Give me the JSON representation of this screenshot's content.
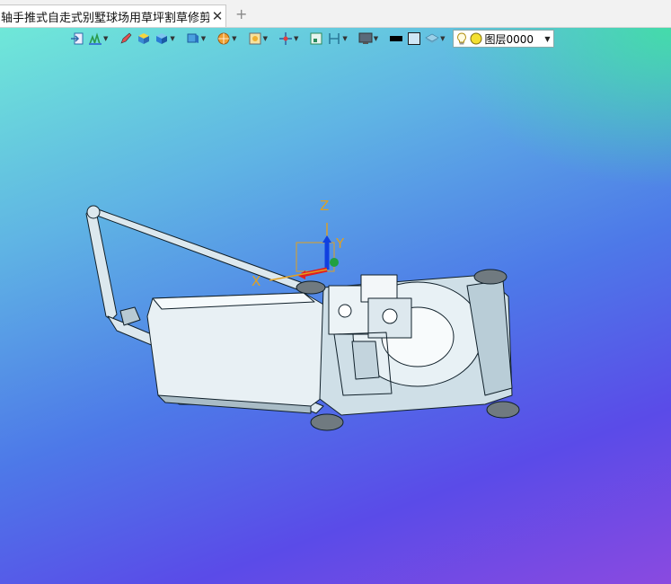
{
  "tab": {
    "title": "轴手推式自走式别墅球场用草坪割草修剪机]",
    "close_glyph": "✕",
    "new_tab_glyph": "+"
  },
  "toolbar": {
    "items": [
      "import-icon",
      "lawn-tool-icon",
      "pencil-icon",
      "cube-yellow-icon",
      "cube-blue-icon",
      "view-cube-icon",
      "render-style-icon",
      "image-frame-icon",
      "axis-move-icon",
      "fit-box-icon",
      "section-icon",
      "display-icon",
      "black-swatch",
      "white-swatch",
      "layer-stack-icon"
    ],
    "layer": {
      "name": "图层0000"
    }
  },
  "viewport": {
    "axes": {
      "x": "X",
      "y": "Y",
      "z": "Z"
    },
    "colors": {
      "top": "#6fe8d8",
      "mid": "#4d79e8",
      "bottom": "#8a4ae0",
      "corner": "#3ceb96"
    }
  }
}
